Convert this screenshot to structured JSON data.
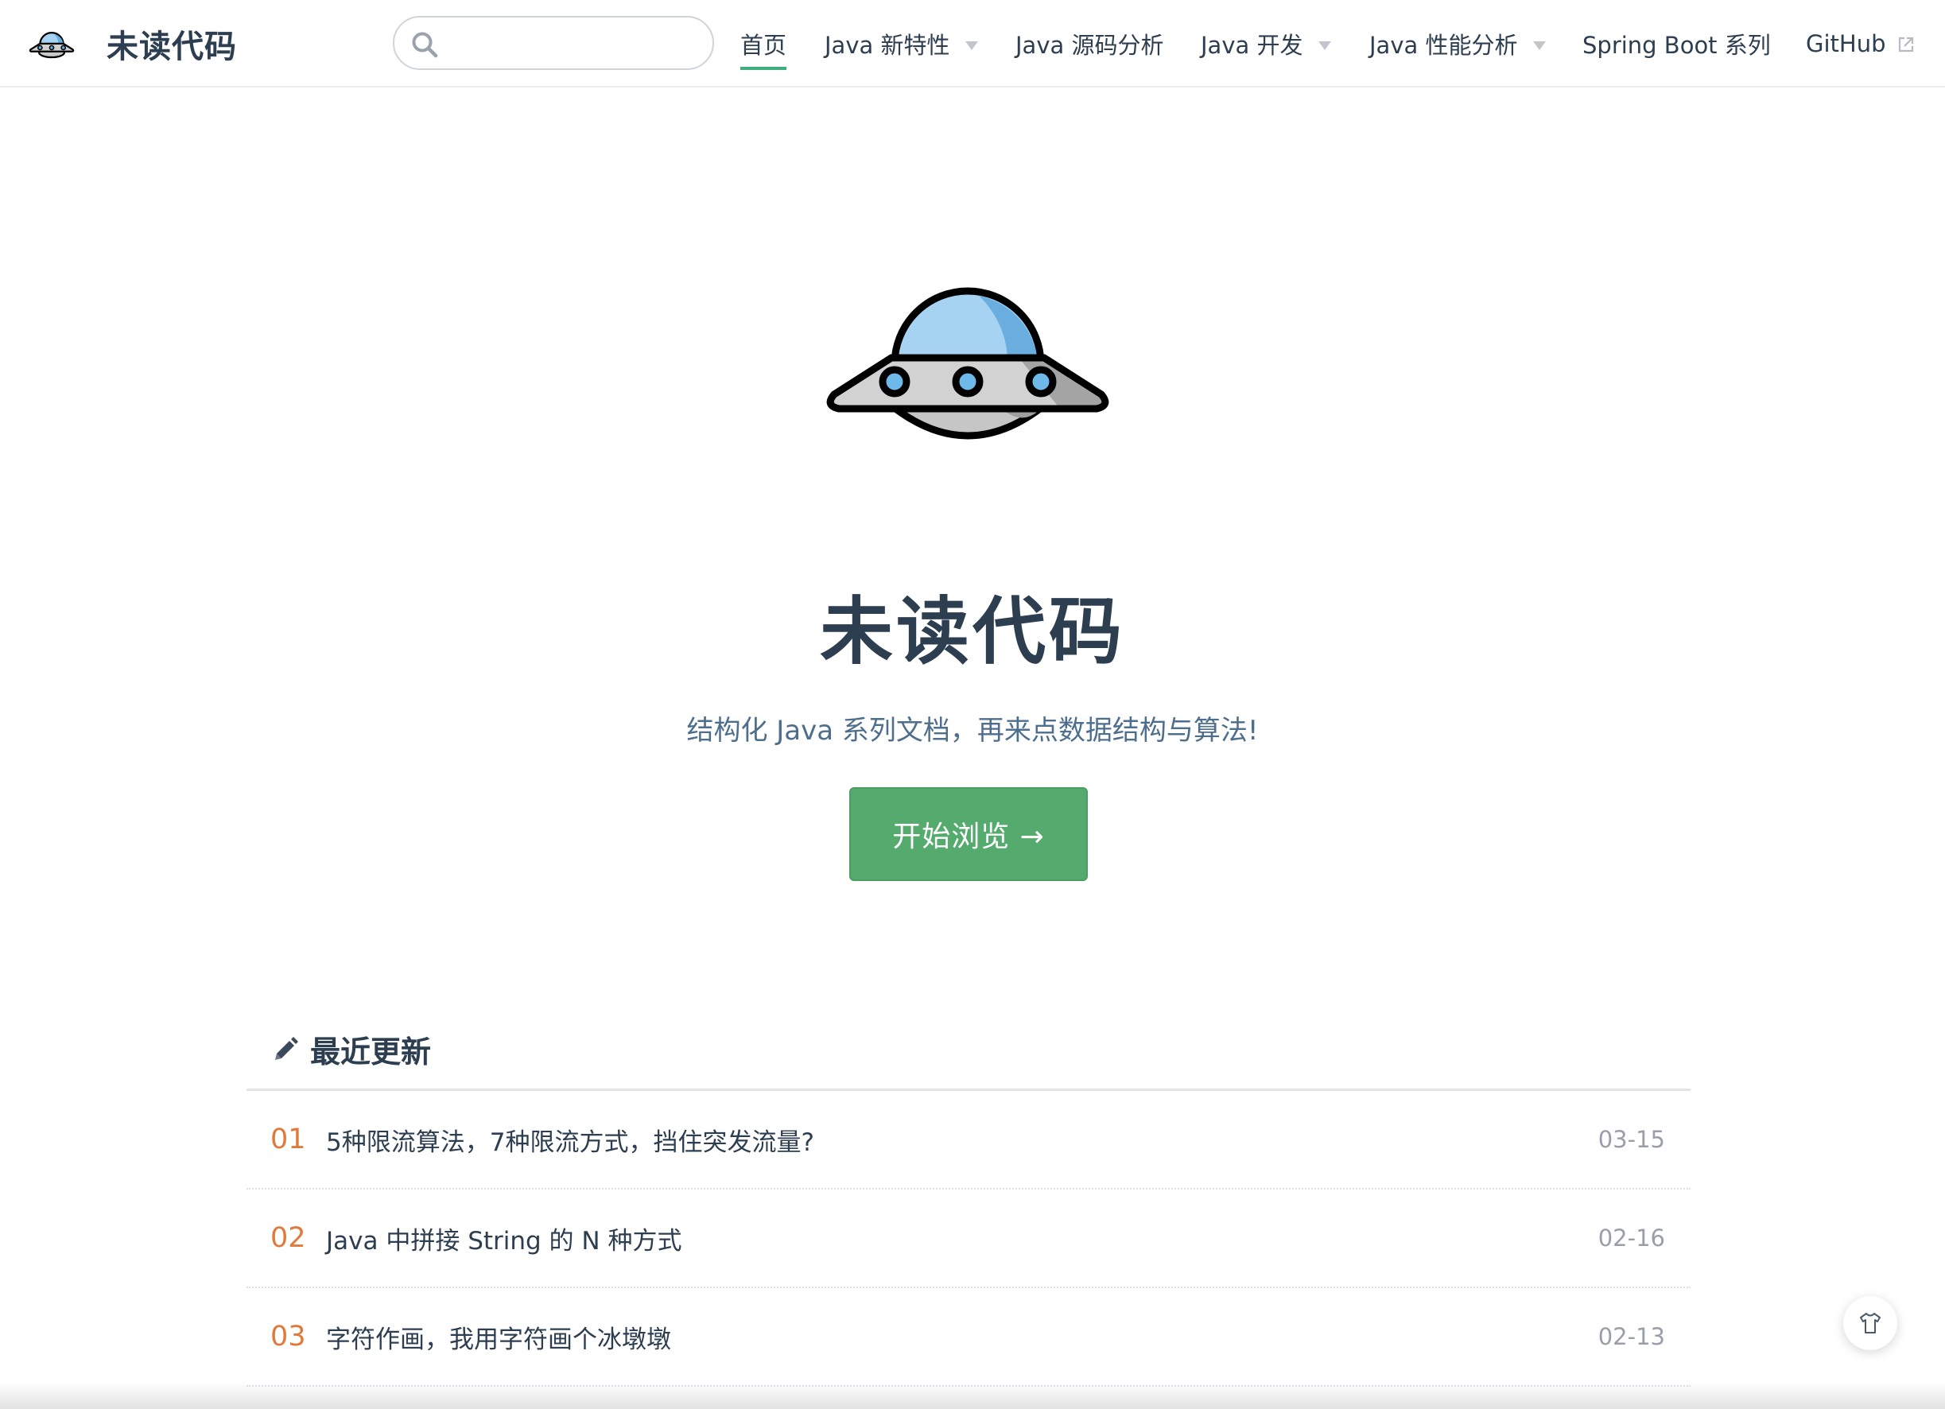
{
  "brand": {
    "title": "未读代码",
    "logo_icon": "ufo-icon"
  },
  "search": {
    "value": "",
    "placeholder": ""
  },
  "nav": {
    "items": [
      {
        "label": "首页",
        "active": true,
        "dropdown": false
      },
      {
        "label": "Java 新特性",
        "active": false,
        "dropdown": true
      },
      {
        "label": "Java 源码分析",
        "active": false,
        "dropdown": false
      },
      {
        "label": "Java 开发",
        "active": false,
        "dropdown": true
      },
      {
        "label": "Java 性能分析",
        "active": false,
        "dropdown": true
      },
      {
        "label": "Spring Boot 系列",
        "active": false,
        "dropdown": false
      },
      {
        "label": "GitHub",
        "active": false,
        "dropdown": false,
        "external": true
      }
    ]
  },
  "hero": {
    "title": "未读代码",
    "description": "结构化 Java 系列文档，再来点数据结构与算法!",
    "cta_label": "开始浏览 →"
  },
  "recent": {
    "title": "最近更新",
    "icon": "pencil-icon",
    "posts": [
      {
        "num": "01",
        "title": "5种限流算法，7种限流方式，挡住突发流量?",
        "date": "03-15"
      },
      {
        "num": "02",
        "title": "Java 中拼接 String 的 N 种方式",
        "date": "02-16"
      },
      {
        "num": "03",
        "title": "字符作画，我用字符画个冰墩墩",
        "date": "02-13"
      }
    ]
  },
  "colors": {
    "accent": "#3eaf7c",
    "button": "#55ab6d",
    "text": "#2c3e50",
    "number": "#e07a3c",
    "date": "#999fa8"
  }
}
